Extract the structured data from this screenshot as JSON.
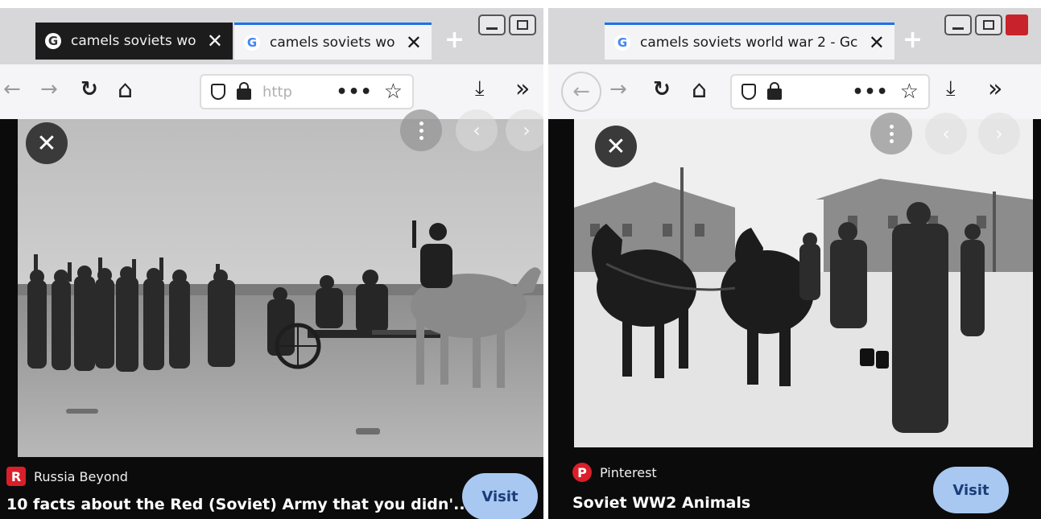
{
  "left_window": {
    "tabs": [
      {
        "favicon": "google-favicon",
        "favicon_glyph": "G",
        "title": "camels soviets wo",
        "state": "inactive",
        "close_glyph": "✕"
      },
      {
        "favicon": "google-favicon",
        "favicon_glyph": "G",
        "title": "camels soviets wor",
        "state": "active",
        "close_glyph": "✕"
      }
    ],
    "new_tab_glyph": "+",
    "toolbar": {
      "back_glyph": "←",
      "forward_glyph": "→",
      "reload_glyph": "↻",
      "home_glyph": "⌂",
      "url_text": "http",
      "more_glyph": "•••",
      "bookmark_glyph": "☆",
      "download_glyph": "⤓",
      "overflow_glyph": "»"
    },
    "viewer": {
      "close_glyph": "✕",
      "prev_glyph": "‹",
      "next_glyph": "›"
    },
    "source": {
      "icon": "russia-beyond-icon",
      "icon_glyph": "R",
      "name": "Russia Beyond"
    },
    "caption": "10 facts about the Red (Soviet) Army that you didn'...",
    "visit_label": "Visit"
  },
  "right_window": {
    "tabs": [
      {
        "favicon": "google-favicon",
        "favicon_glyph": "G",
        "title": "camels soviets world war 2 - Gc",
        "state": "active",
        "close_glyph": "✕"
      }
    ],
    "new_tab_glyph": "+",
    "toolbar": {
      "back_glyph": "←",
      "forward_glyph": "→",
      "reload_glyph": "↻",
      "home_glyph": "⌂",
      "url_text": "",
      "more_glyph": "•••",
      "bookmark_glyph": "☆",
      "download_glyph": "⤓",
      "overflow_glyph": "»"
    },
    "viewer": {
      "close_glyph": "✕",
      "prev_glyph": "‹",
      "next_glyph": "›"
    },
    "source": {
      "icon": "pinterest-icon",
      "icon_glyph": "P",
      "name": "Pinterest"
    },
    "caption": "Soviet WW2 Animals",
    "visit_label": "Visit"
  },
  "colors": {
    "tab_active_accent": "#1d72e8",
    "visit_button": "#a8c8f2",
    "viewer_background": "#0b0b0b",
    "brand_red": "#d81f2a"
  }
}
